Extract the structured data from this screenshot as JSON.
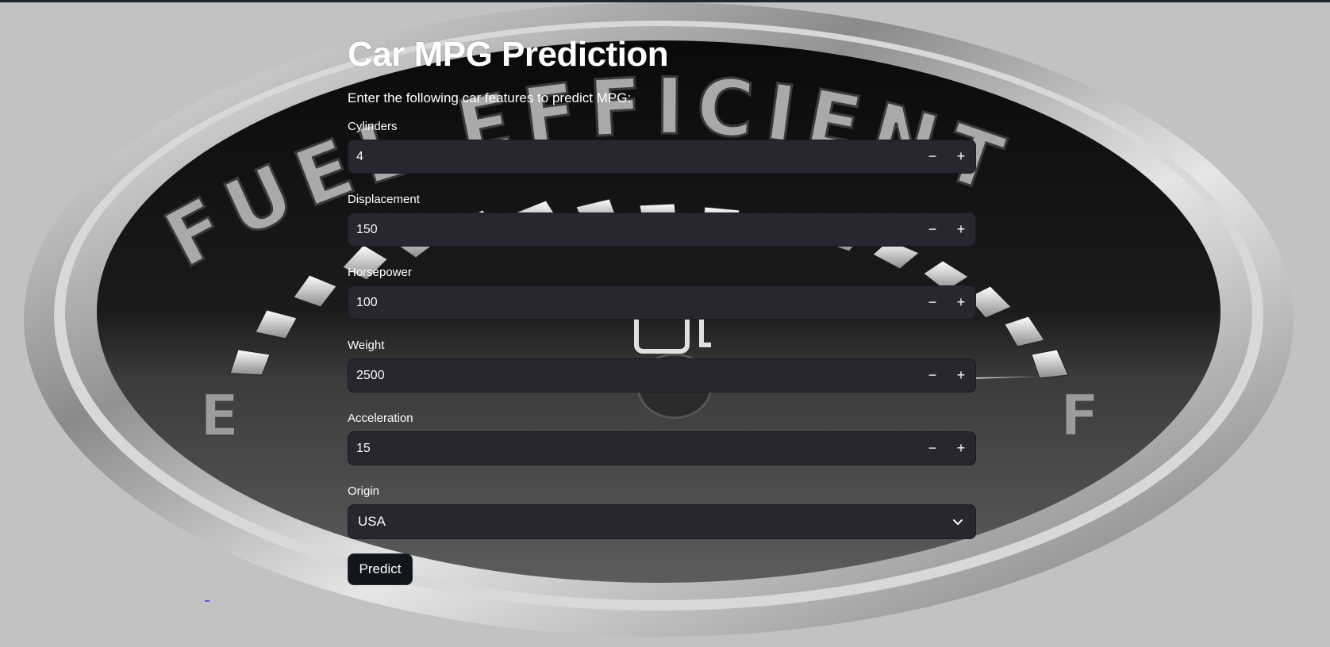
{
  "page": {
    "title": "Car MPG Prediction",
    "intro": "Enter the following car features to predict MPG:"
  },
  "background": {
    "gauge_word": "FUEL EFFICIENT",
    "empty_mark": "E",
    "full_mark": "F"
  },
  "fields": {
    "cylinders": {
      "label": "Cylinders",
      "value": "4"
    },
    "displacement": {
      "label": "Displacement",
      "value": "150"
    },
    "horsepower": {
      "label": "Horsepower",
      "value": "100"
    },
    "weight": {
      "label": "Weight",
      "value": "2500"
    },
    "acceleration": {
      "label": "Acceleration",
      "value": "15"
    }
  },
  "stepper": {
    "minus": "−",
    "plus": "+"
  },
  "origin": {
    "label": "Origin",
    "selected": "USA"
  },
  "actions": {
    "predict_label": "Predict"
  },
  "icons": {
    "dropdown": "chevron-down-icon",
    "gauge": "fuel-pump-icon"
  },
  "colors": {
    "input_bg": "#262730",
    "page_bg": "#c3c3c3",
    "button_bg": "#11151c",
    "text": "#ffffff"
  }
}
